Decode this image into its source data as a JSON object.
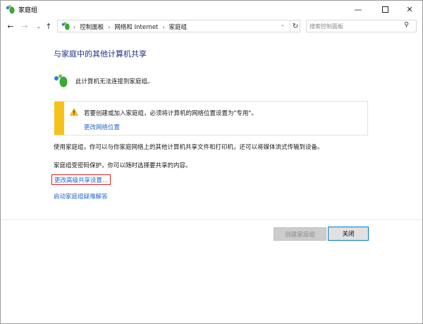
{
  "window": {
    "title": "家庭组",
    "controls": {
      "minimize": "—",
      "close": "✕"
    }
  },
  "nav": {
    "back": "←",
    "forward": "→",
    "recent": "⌄",
    "up": "↑",
    "breadcrumbs": [
      "控制面板",
      "网络和 Internet",
      "家庭组"
    ],
    "separator": "›",
    "dropdown": "⌄",
    "refresh": "↻",
    "search_placeholder": "搜索控制面板",
    "search_icon_glyph": "⚲"
  },
  "main": {
    "title": "与家庭中的其他计算机共享",
    "status_text": "此计算机无法连接到家庭组。",
    "warning": {
      "text": "若要创建或加入家庭组，必须将计算机的网络位置设置为\"专用\"。",
      "link": "更改网络位置"
    },
    "description1": "使用家庭组，你可以与你家庭网络上的其他计算机共享文件和打印机，还可以将媒体流式传输到设备。",
    "description2": "家庭组受密码保护，你可以随时选择要共享的内容。",
    "links": {
      "change_advanced": "更改高级共享设置...",
      "troubleshooter": "启动家庭组疑难解答"
    }
  },
  "buttons": {
    "create": "创建家庭组",
    "close": "关闭"
  },
  "colors": {
    "title_blue": "#1e3287",
    "link_blue": "#2266cc",
    "warning_yellow": "#f6c21a",
    "highlight_red": "#e02020",
    "focus_blue": "#0078d7"
  }
}
